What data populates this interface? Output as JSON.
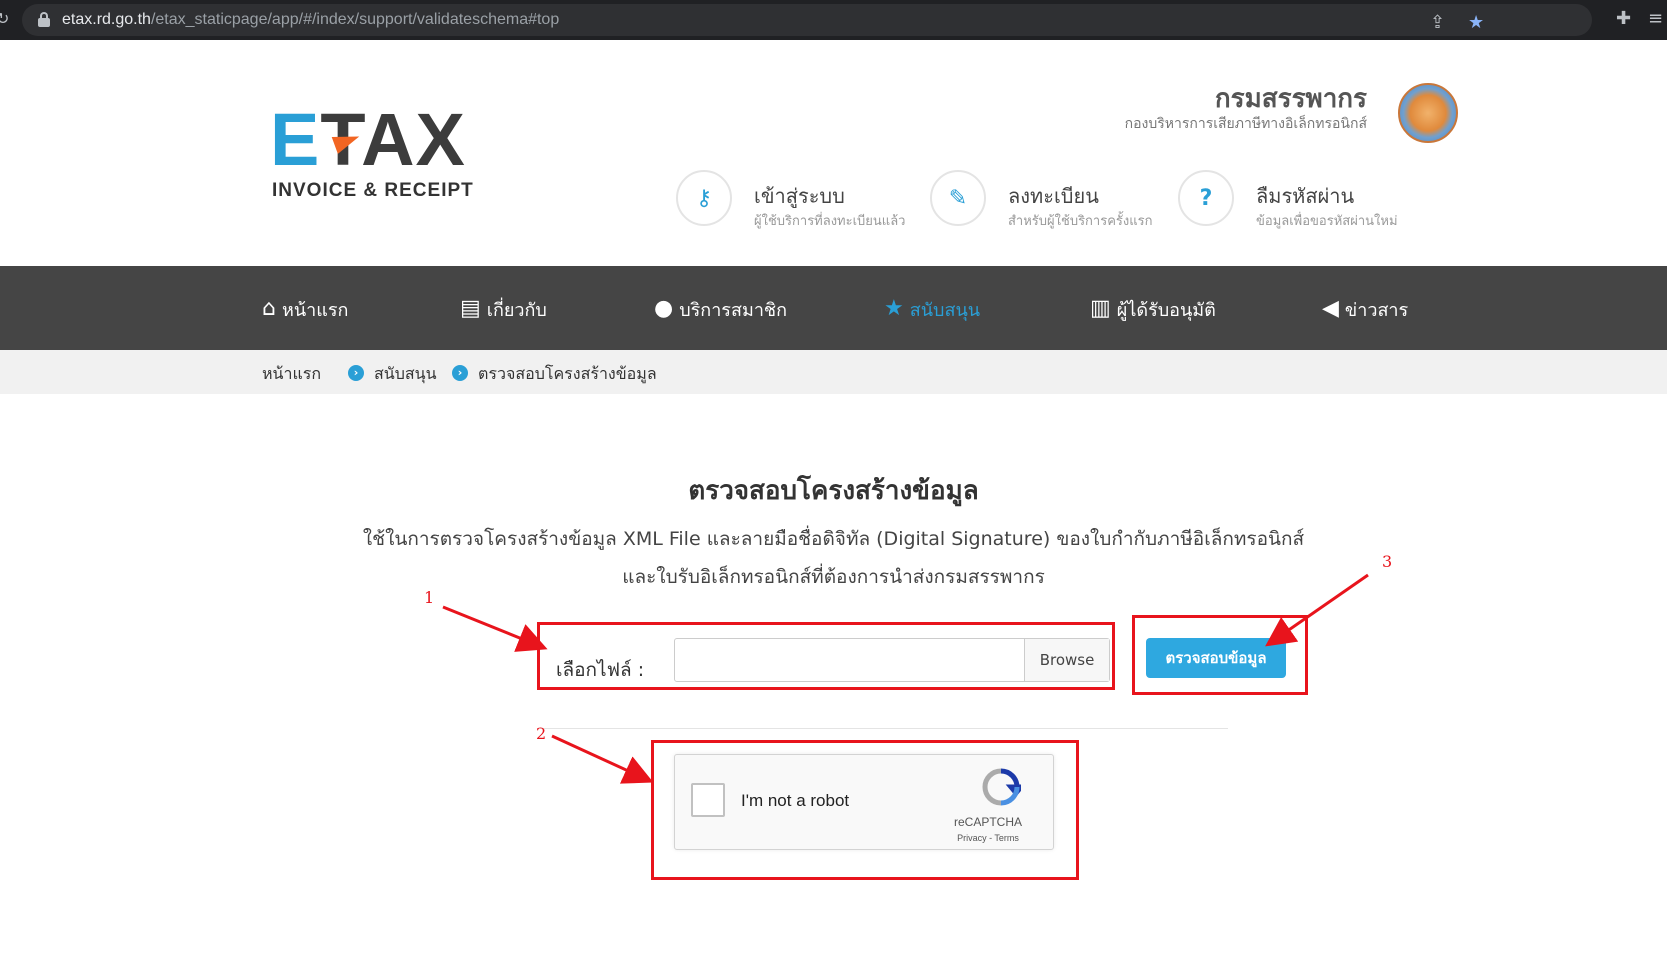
{
  "browser": {
    "url_host": "etax.rd.go.th",
    "url_path": "/etax_staticpage/app/#/index/support/validateschema#top"
  },
  "header": {
    "logo_e": "E",
    "logo_tax": "TAX",
    "logo_tagline": "INVOICE & RECEIPT",
    "org_name": "กรมสรรพากร",
    "org_sub": "กองบริหารการเสียภาษีทางอิเล็กทรอนิกส์",
    "quick_links": [
      {
        "title": "เข้าสู่ระบบ",
        "sub": "ผู้ใช้บริการที่ลงทะเบียนแล้ว",
        "icon": "key-icon"
      },
      {
        "title": "ลงทะเบียน",
        "sub": "สำหรับผู้ใช้บริการครั้งแรก",
        "icon": "edit-icon"
      },
      {
        "title": "ลืมรหัสผ่าน",
        "sub": "ข้อมูลเพื่อขอรหัสผ่านใหม่",
        "icon": "question-icon"
      }
    ]
  },
  "nav": {
    "items": [
      {
        "label": "หน้าแรก",
        "icon": "home-icon"
      },
      {
        "label": "เกี่ยวกับ",
        "icon": "document-icon"
      },
      {
        "label": "บริการสมาชิก",
        "icon": "user-icon"
      },
      {
        "label": "สนับสนุน",
        "icon": "star-icon"
      },
      {
        "label": "ผู้ได้รับอนุมัติ",
        "icon": "book-icon"
      },
      {
        "label": "ข่าวสาร",
        "icon": "megaphone-icon"
      }
    ],
    "active_index": 3
  },
  "breadcrumb": [
    "หน้าแรก",
    "สนับสนุน",
    "ตรวจสอบโครงสร้างข้อมูล"
  ],
  "main": {
    "title": "ตรวจสอบโครงสร้างข้อมูล",
    "desc_line1": "ใช้ในการตรวจโครงสร้างข้อมูล XML File และลายมือชื่อดิจิทัล (Digital Signature) ของใบกำกับภาษีอิเล็กทรอนิกส์",
    "desc_line2": "และใบรับอิเล็กทรอนิกส์ที่ต้องการนำส่งกรมสรรพากร",
    "file_label": "เลือกไฟล์ :",
    "file_value": "",
    "browse_label": "Browse",
    "check_button": "ตรวจสอบข้อมูล"
  },
  "recaptcha": {
    "label": "I'm not a robot",
    "brand": "reCAPTCHA",
    "links": "Privacy - Terms"
  },
  "annotations": [
    "1",
    "2",
    "3"
  ],
  "colors": {
    "accent": "#2a9fd6",
    "nav_bg": "#454545",
    "annotation": "#e8141c"
  }
}
